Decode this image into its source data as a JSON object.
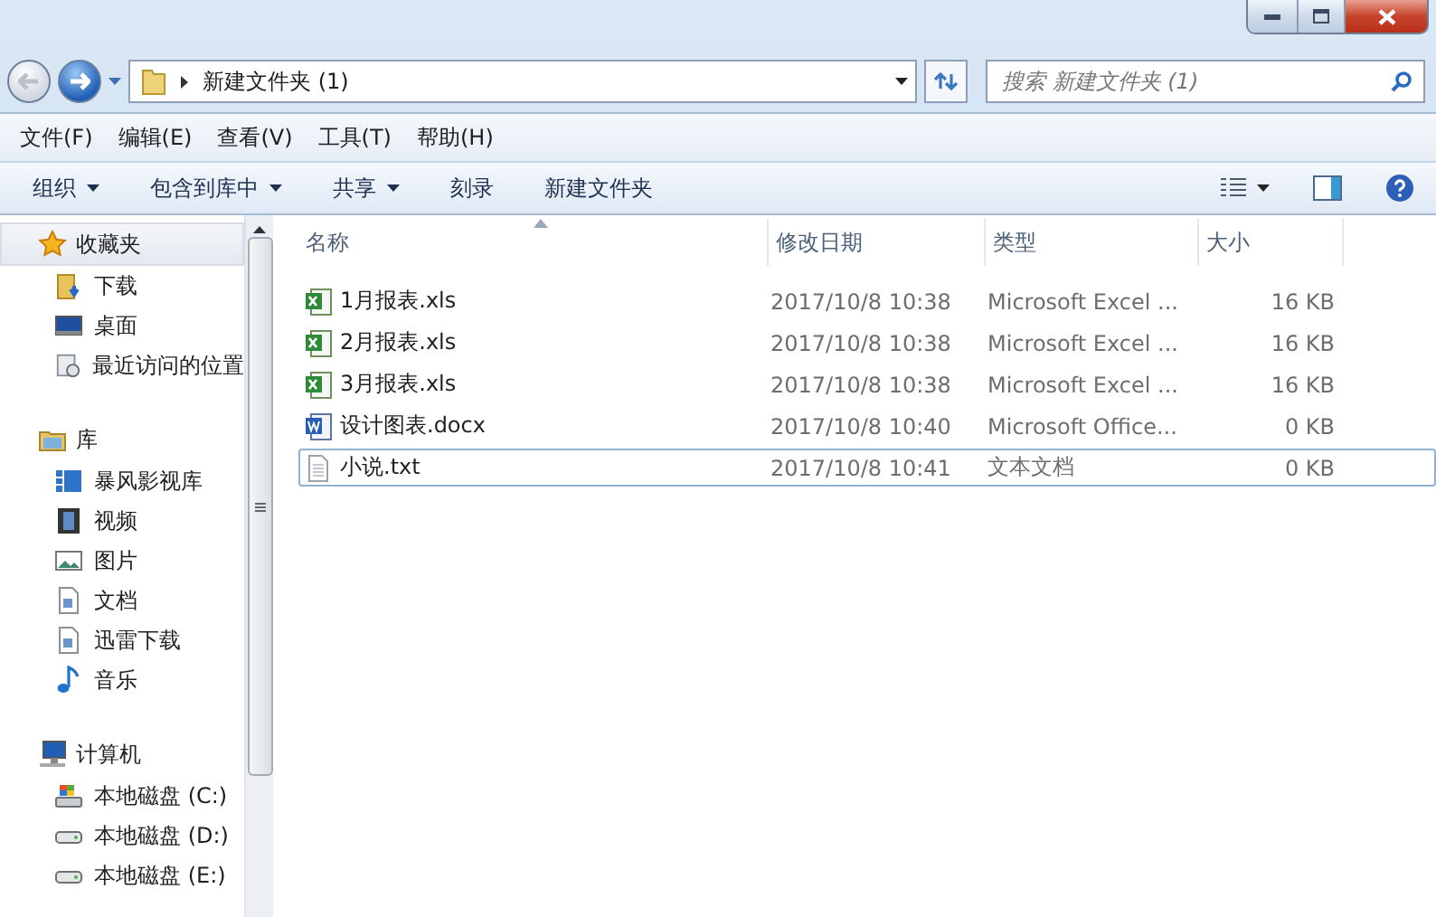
{
  "address": {
    "crumbs": [
      "新建文件夹 (1)"
    ]
  },
  "search": {
    "placeholder": "搜索 新建文件夹 (1)"
  },
  "menu": [
    "文件(F)",
    "编辑(E)",
    "查看(V)",
    "工具(T)",
    "帮助(H)"
  ],
  "commands": [
    {
      "label": "组织",
      "dropdown": true
    },
    {
      "label": "包含到库中",
      "dropdown": true
    },
    {
      "label": "共享",
      "dropdown": true
    },
    {
      "label": "刻录",
      "dropdown": false
    },
    {
      "label": "新建文件夹",
      "dropdown": false
    }
  ],
  "sidebar": [
    {
      "label": "收藏夹",
      "selected": true,
      "children": [
        {
          "label": "下载"
        },
        {
          "label": "桌面"
        },
        {
          "label": "最近访问的位置"
        }
      ]
    },
    {
      "label": "库",
      "selected": false,
      "children": [
        {
          "label": "暴风影视库"
        },
        {
          "label": "视频"
        },
        {
          "label": "图片"
        },
        {
          "label": "文档"
        },
        {
          "label": "迅雷下载"
        },
        {
          "label": "音乐"
        }
      ]
    },
    {
      "label": "计算机",
      "selected": false,
      "children": [
        {
          "label": "本地磁盘 (C:)"
        },
        {
          "label": "本地磁盘 (D:)"
        },
        {
          "label": "本地磁盘 (E:)"
        }
      ]
    }
  ],
  "table": {
    "columns": [
      {
        "label": "名称",
        "sorted": true
      },
      {
        "label": "修改日期",
        "sorted": false
      },
      {
        "label": "类型",
        "sorted": false
      },
      {
        "label": "大小",
        "sorted": false
      }
    ],
    "rows": [
      {
        "kind": "xls",
        "name": "1月报表.xls",
        "date": "2017/10/8 10:38",
        "type": "Microsoft Excel ...",
        "size": "16 KB",
        "focused": false
      },
      {
        "kind": "xls",
        "name": "2月报表.xls",
        "date": "2017/10/8 10:38",
        "type": "Microsoft Excel ...",
        "size": "16 KB",
        "focused": false
      },
      {
        "kind": "xls",
        "name": "3月报表.xls",
        "date": "2017/10/8 10:38",
        "type": "Microsoft Excel ...",
        "size": "16 KB",
        "focused": false
      },
      {
        "kind": "docx",
        "name": "设计图表.docx",
        "date": "2017/10/8 10:40",
        "type": "Microsoft Office...",
        "size": "0 KB",
        "focused": false
      },
      {
        "kind": "txt",
        "name": "小说.txt",
        "date": "2017/10/8 10:41",
        "type": "文本文档",
        "size": "0 KB",
        "focused": true
      }
    ]
  }
}
